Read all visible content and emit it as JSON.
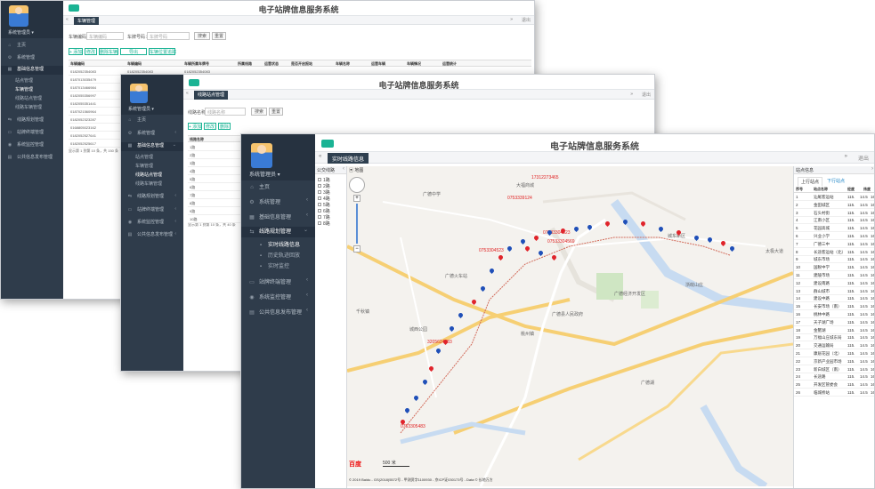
{
  "app_title": "电子站牌信息服务系统",
  "user": "系统管理员 ▾",
  "exit_label": "退出",
  "menu": {
    "home": "主页",
    "system": "系统管理",
    "basic": "基础信息管理",
    "stop_manage": "站点管理",
    "vehicle_manage": "车辆管理",
    "route_manage": "线路站点管理",
    "route_vehicle": "线路车辆管理",
    "route_plan": "线路规划管理",
    "realtime_info": "实时线路信息",
    "history_track": "历史轨迹回放",
    "realtime_monitor": "实时监控",
    "board_terminal": "站牌终端管理",
    "sys_monitor": "系统监控管理",
    "publish": "公共信息发布管理"
  },
  "win1": {
    "tab": "车辆管理",
    "label_no": "车辆编码：",
    "ph_no": "车辆编码",
    "label_plate": "车牌号码：",
    "ph_plate": "车牌号码",
    "search": "搜索",
    "reset": "重置",
    "btns": [
      "+ 添加",
      "修改",
      "删除车辆",
      "导出",
      "车辆位置追踪"
    ],
    "headers": [
      "车辆编码",
      "车辆编码",
      "车辆所属车牌号",
      "所属线路",
      "运营状态",
      "是否开启报站",
      "车辆名称",
      "运营车辆",
      "车辆情况",
      "运营统计"
    ],
    "rows": [
      [
        "0182052354083",
        "0182052354083",
        "0182052354083"
      ],
      [
        "0187013035479"
      ],
      [
        "0187013466984"
      ],
      [
        "0182055356997"
      ],
      [
        "0182055351441"
      ],
      [
        "0187021560964"
      ],
      [
        "0182052323287"
      ],
      [
        "0168805023162"
      ],
      [
        "0182052527641"
      ],
      [
        "0182052525617"
      ]
    ],
    "pager": "显示第 1 到第 10 条，共 150 条"
  },
  "win2": {
    "tab": "线路站点管理",
    "label": "线路名称：",
    "ph": "线路名称",
    "search": "搜索",
    "reset": "重置",
    "btns": [
      "+ 添加",
      "修改",
      "删除"
    ],
    "header": "线路名称",
    "rows": [
      "1路",
      "2路",
      "3路",
      "4路",
      "5路",
      "6路",
      "7路",
      "8路",
      "9路",
      "10路"
    ],
    "pager": "显示第 1 到第 10 条，共 40 条"
  },
  "win3": {
    "tab": "实时线路信息",
    "route_header": "公交线路",
    "map_label": "地图",
    "routes": [
      "1路",
      "2路",
      "3路",
      "4路",
      "5路",
      "6路",
      "7路",
      "8路"
    ],
    "station_header": "站点信息",
    "tabs": [
      "上行站点",
      "下行站点"
    ],
    "cols": [
      "序号",
      "站点名称",
      "经度",
      "纬度"
    ],
    "stations": [
      [
        "1",
        "汕尾客运站"
      ],
      [
        "2",
        "金田城区"
      ],
      [
        "3",
        "石头村街"
      ],
      [
        "4",
        "江南小区"
      ],
      [
        "5",
        "花园高城"
      ],
      [
        "6",
        "兴业小学"
      ],
      [
        "7",
        "广德三中"
      ],
      [
        "8",
        "长途客运站（北）"
      ],
      [
        "9",
        "城东市场"
      ],
      [
        "10",
        "国税中学"
      ],
      [
        "11",
        "建陵市场"
      ],
      [
        "12",
        "建设南路"
      ],
      [
        "13",
        "群山城市"
      ],
      [
        "14",
        "建设中路"
      ],
      [
        "15",
        "长安市场（南）"
      ],
      [
        "16",
        "桃林中路"
      ],
      [
        "17",
        "天子湖广场"
      ],
      [
        "18",
        "金鳌湖"
      ],
      [
        "19",
        "万福山庄城东局"
      ],
      [
        "20",
        "交通运输局"
      ],
      [
        "21",
        "康居花园（北）"
      ],
      [
        "22",
        "京新产业园市场"
      ],
      [
        "23",
        "新白城区（南）"
      ],
      [
        "24",
        "长途路"
      ],
      [
        "25",
        "开发区管委会"
      ],
      [
        "26",
        "临城桥站"
      ]
    ],
    "lng": "115.",
    "lat": "14.5",
    "extra": "16",
    "map_labels": {
      "a": "大福商城",
      "b": "广德中学",
      "c": "广德县人民政府",
      "d": "城东新区",
      "e": "太极大道",
      "f": "广德火车站",
      "g": "桃州镇",
      "h": "广德经济开发区",
      "i": "城西公园",
      "j": "浙皖山庄",
      "k": "广德湖",
      "l": "千秋镇"
    },
    "phone_labels": [
      "17312273465",
      "0753339124",
      "07533304523",
      "0753304523",
      "07533304569",
      "3205624183",
      "0753305483"
    ],
    "baidu": "百度",
    "copyright": "© 2019 Baidu - GS(2018)5572号 - 甲测资字1100930 - 京ICP证030173号 - Data © 长地万方",
    "scale": "500 米"
  }
}
